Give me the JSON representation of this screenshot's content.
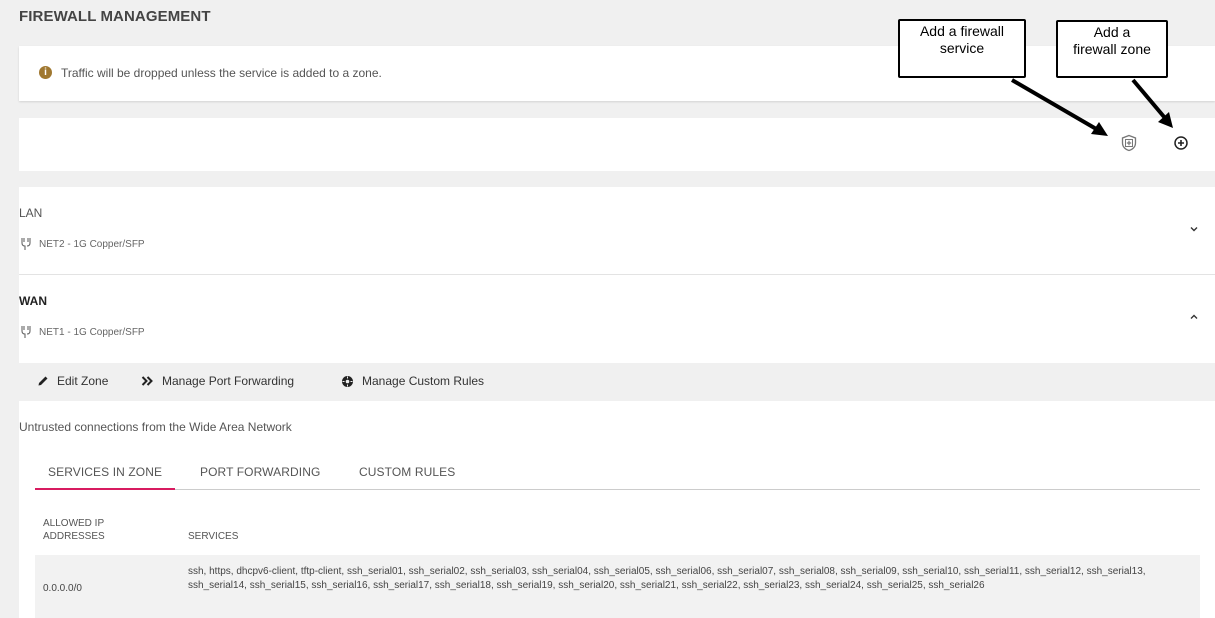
{
  "page": {
    "title": "FIREWALL MANAGEMENT"
  },
  "notice": {
    "icon": "info-icon",
    "icon_char": "i",
    "text": "Traffic will be dropped unless the service is added to a zone."
  },
  "actions": {
    "add_service_icon": "shield-plus-icon",
    "add_zone_icon": "plus-circle-icon"
  },
  "zones": [
    {
      "name": "LAN",
      "interface": "NET2 - 1G Copper/SFP",
      "expanded": false
    },
    {
      "name": "WAN",
      "interface": "NET1 - 1G Copper/SFP",
      "expanded": true
    }
  ],
  "toolbar": {
    "edit_zone": "Edit Zone",
    "manage_port_forwarding": "Manage Port Forwarding",
    "manage_custom_rules": "Manage Custom Rules"
  },
  "wan_detail": {
    "description": "Untrusted connections from the Wide Area Network",
    "tabs": [
      "SERVICES IN ZONE",
      "PORT FORWARDING",
      "CUSTOM RULES"
    ],
    "active_tab": "SERVICES IN ZONE",
    "table": {
      "headers": {
        "ip": [
          "ALLOWED IP",
          "ADDRESSES"
        ],
        "services": "SERVICES"
      },
      "rows": [
        {
          "ip": "0.0.0.0/0",
          "services": "ssh, https, dhcpv6-client, tftp-client, ssh_serial01, ssh_serial02, ssh_serial03, ssh_serial04, ssh_serial05, ssh_serial06, ssh_serial07, ssh_serial08, ssh_serial09, ssh_serial10, ssh_serial11, ssh_serial12, ssh_serial13, ssh_serial14, ssh_serial15, ssh_serial16, ssh_serial17, ssh_serial18, ssh_serial19, ssh_serial20, ssh_serial21, ssh_serial22, ssh_serial23, ssh_serial24, ssh_serial25, ssh_serial26"
        }
      ]
    }
  },
  "callouts": {
    "add_service": [
      "Add a firewall",
      "service"
    ],
    "add_zone": [
      "Add a",
      "firewall zone"
    ]
  },
  "colors": {
    "accent": "#d81b60",
    "notice_icon": "#a07830",
    "background": "#f0f0f0"
  }
}
